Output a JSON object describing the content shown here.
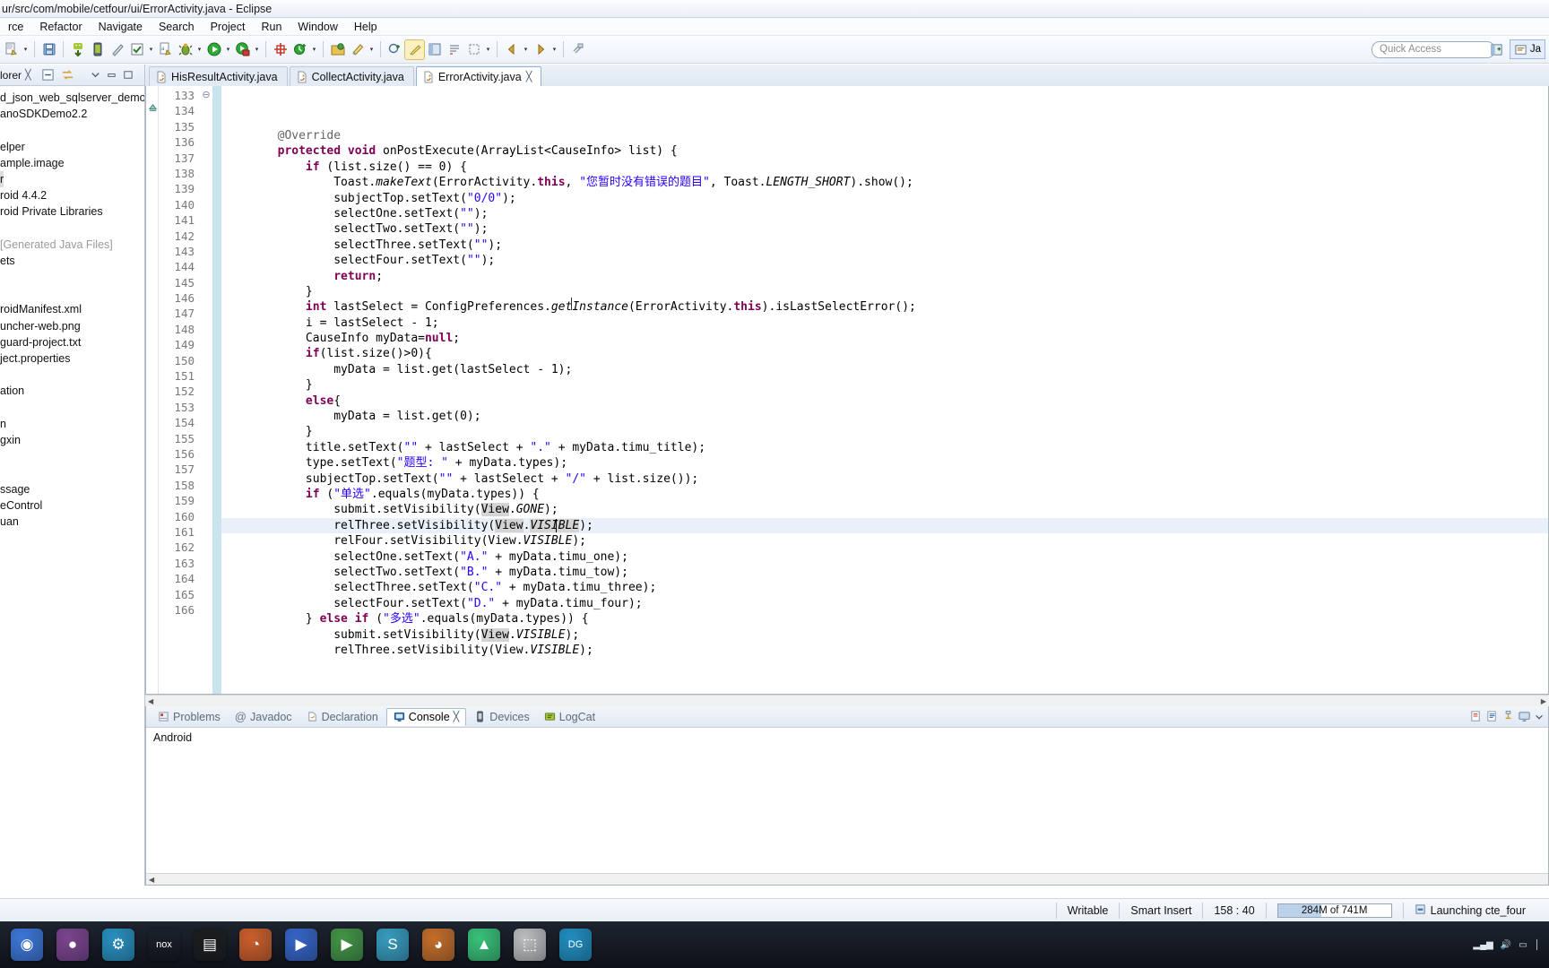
{
  "window": {
    "title": "ur/src/com/mobile/cetfour/ui/ErrorActivity.java - Eclipse"
  },
  "menubar": {
    "items": [
      "rce",
      "Refactor",
      "Navigate",
      "Search",
      "Project",
      "Run",
      "Window",
      "Help"
    ]
  },
  "toolbar": {
    "quick_access_placeholder": "Quick Access",
    "icons": [
      "new-wizard-icon",
      "save-icon",
      "android-sdk-manager-icon",
      "android-avd-manager-icon",
      "new-xml-file-icon",
      "check-icon",
      "new-java-class-icon",
      "debug-icon",
      "run-icon",
      "run-coverage-icon",
      "new-android-icon",
      "external-tools-icon",
      "open-type-icon",
      "search-icon",
      "next-annotation-icon",
      "java-perspective-icon",
      "open-perspective-icon"
    ],
    "perspective_label": "Ja"
  },
  "explorer": {
    "tab_label": "lorer",
    "tab_close": "╳",
    "toolbar_icons": [
      "collapse-all-icon",
      "link-with-editor-icon",
      "view-menu-icon",
      "minimize-icon",
      "maximize-icon"
    ],
    "tree": [
      {
        "label": "d_json_web_sqlserver_demo",
        "style": "normal"
      },
      {
        "label": "anoSDKDemo2.2",
        "style": "normal"
      },
      {
        "label": "",
        "style": "blank"
      },
      {
        "label": "elper",
        "style": "normal"
      },
      {
        "label": "ample.image",
        "style": "normal"
      },
      {
        "label": "r",
        "style": "selected"
      },
      {
        "label": "roid 4.4.2",
        "style": "normal"
      },
      {
        "label": "roid Private Libraries",
        "style": "normal"
      },
      {
        "label": "",
        "style": "blank"
      },
      {
        "label": "[Generated Java Files]",
        "style": "gray"
      },
      {
        "label": "ets",
        "style": "normal"
      },
      {
        "label": "",
        "style": "blank"
      },
      {
        "label": "",
        "style": "blank"
      },
      {
        "label": "roidManifest.xml",
        "style": "normal"
      },
      {
        "label": "uncher-web.png",
        "style": "normal"
      },
      {
        "label": "guard-project.txt",
        "style": "normal"
      },
      {
        "label": "ject.properties",
        "style": "normal"
      },
      {
        "label": "",
        "style": "blank"
      },
      {
        "label": "ation",
        "style": "normal"
      },
      {
        "label": "",
        "style": "blank"
      },
      {
        "label": "n",
        "style": "normal"
      },
      {
        "label": "gxin",
        "style": "normal"
      },
      {
        "label": "",
        "style": "blank"
      },
      {
        "label": "",
        "style": "blank"
      },
      {
        "label": "ssage",
        "style": "normal"
      },
      {
        "label": "eControl",
        "style": "normal"
      },
      {
        "label": "uan",
        "style": "normal"
      }
    ]
  },
  "editor": {
    "tabs": [
      {
        "label": "HisResultActivity.java",
        "active": false,
        "closable": false
      },
      {
        "label": "CollectActivity.java",
        "active": false,
        "closable": false
      },
      {
        "label": "ErrorActivity.java",
        "active": true,
        "closable": true,
        "close_glyph": "╳"
      }
    ],
    "first_line": 133,
    "lines": [
      {
        "n": 133,
        "fold": "collapse",
        "tokens": [
          {
            "t": "        ",
            "c": ""
          },
          {
            "t": "@Override",
            "c": "ann"
          }
        ]
      },
      {
        "n": 134,
        "mark": "overrides",
        "tokens": [
          {
            "t": "        ",
            "c": ""
          },
          {
            "t": "protected void",
            "c": "kw"
          },
          {
            "t": " onPostExecute(ArrayList<CauseInfo> list) {",
            "c": ""
          }
        ]
      },
      {
        "n": 135,
        "tokens": [
          {
            "t": "            ",
            "c": ""
          },
          {
            "t": "if",
            "c": "kw"
          },
          {
            "t": " (list.size() == 0) {",
            "c": ""
          }
        ]
      },
      {
        "n": 136,
        "tokens": [
          {
            "t": "                Toast.",
            "c": ""
          },
          {
            "t": "makeText",
            "c": "stat"
          },
          {
            "t": "(ErrorActivity.",
            "c": ""
          },
          {
            "t": "this",
            "c": "kw"
          },
          {
            "t": ", ",
            "c": ""
          },
          {
            "t": "\"您暂时没有错误的题目\"",
            "c": "str"
          },
          {
            "t": ", Toast.",
            "c": ""
          },
          {
            "t": "LENGTH_SHORT",
            "c": "stat"
          },
          {
            "t": ").show();",
            "c": ""
          }
        ]
      },
      {
        "n": 137,
        "tokens": [
          {
            "t": "                subjectTop.setText(",
            "c": ""
          },
          {
            "t": "\"0/0\"",
            "c": "str"
          },
          {
            "t": ");",
            "c": ""
          }
        ]
      },
      {
        "n": 138,
        "tokens": [
          {
            "t": "                selectOne.setText(",
            "c": ""
          },
          {
            "t": "\"\"",
            "c": "str"
          },
          {
            "t": ");",
            "c": ""
          }
        ]
      },
      {
        "n": 139,
        "tokens": [
          {
            "t": "                selectTwo.setText(",
            "c": ""
          },
          {
            "t": "\"\"",
            "c": "str"
          },
          {
            "t": ");",
            "c": ""
          }
        ]
      },
      {
        "n": 140,
        "tokens": [
          {
            "t": "                selectThree.setText(",
            "c": ""
          },
          {
            "t": "\"\"",
            "c": "str"
          },
          {
            "t": ");",
            "c": ""
          }
        ]
      },
      {
        "n": 141,
        "tokens": [
          {
            "t": "                selectFour.setText(",
            "c": ""
          },
          {
            "t": "\"\"",
            "c": "str"
          },
          {
            "t": ");",
            "c": ""
          }
        ]
      },
      {
        "n": 142,
        "tokens": [
          {
            "t": "                ",
            "c": ""
          },
          {
            "t": "return",
            "c": "kw"
          },
          {
            "t": ";",
            "c": ""
          }
        ]
      },
      {
        "n": 143,
        "tokens": [
          {
            "t": "            }",
            "c": ""
          }
        ]
      },
      {
        "n": 144,
        "tokens": [
          {
            "t": "            ",
            "c": ""
          },
          {
            "t": "int",
            "c": "kw"
          },
          {
            "t": " lastSelect = ConfigPreferences.",
            "c": ""
          },
          {
            "t": "getInstance",
            "c": "stat"
          },
          {
            "t": "(ErrorActivity.",
            "c": ""
          },
          {
            "t": "this",
            "c": "kw"
          },
          {
            "t": ").isLastSelectError();",
            "c": ""
          }
        ]
      },
      {
        "n": 145,
        "tokens": [
          {
            "t": "            i = lastSelect - 1;",
            "c": ""
          }
        ]
      },
      {
        "n": 146,
        "tokens": [
          {
            "t": "            CauseInfo myData=",
            "c": ""
          },
          {
            "t": "null",
            "c": "kw"
          },
          {
            "t": ";",
            "c": ""
          }
        ]
      },
      {
        "n": 147,
        "tokens": [
          {
            "t": "            ",
            "c": ""
          },
          {
            "t": "if",
            "c": "kw"
          },
          {
            "t": "(list.size()>0){",
            "c": ""
          }
        ]
      },
      {
        "n": 148,
        "tokens": [
          {
            "t": "                myData = list.get(lastSelect - 1);",
            "c": ""
          }
        ]
      },
      {
        "n": 149,
        "tokens": [
          {
            "t": "            }",
            "c": ""
          }
        ]
      },
      {
        "n": 150,
        "tokens": [
          {
            "t": "            ",
            "c": ""
          },
          {
            "t": "else",
            "c": "kw"
          },
          {
            "t": "{",
            "c": ""
          }
        ]
      },
      {
        "n": 151,
        "tokens": [
          {
            "t": "                myData = list.get(0);",
            "c": ""
          }
        ]
      },
      {
        "n": 152,
        "tokens": [
          {
            "t": "            }",
            "c": ""
          }
        ]
      },
      {
        "n": 153,
        "tokens": [
          {
            "t": "            title.setText(",
            "c": ""
          },
          {
            "t": "\"\"",
            "c": "str"
          },
          {
            "t": " + lastSelect + ",
            "c": ""
          },
          {
            "t": "\".\"",
            "c": "str"
          },
          {
            "t": " + myData.timu_title);",
            "c": ""
          }
        ]
      },
      {
        "n": 154,
        "tokens": [
          {
            "t": "            type.setText(",
            "c": ""
          },
          {
            "t": "\"题型: \"",
            "c": "str"
          },
          {
            "t": " + myData.types);",
            "c": ""
          }
        ]
      },
      {
        "n": 155,
        "tokens": [
          {
            "t": "            subjectTop.setText(",
            "c": ""
          },
          {
            "t": "\"\"",
            "c": "str"
          },
          {
            "t": " + lastSelect + ",
            "c": ""
          },
          {
            "t": "\"/\"",
            "c": "str"
          },
          {
            "t": " + list.size());",
            "c": ""
          }
        ]
      },
      {
        "n": 156,
        "tokens": [
          {
            "t": "            ",
            "c": ""
          },
          {
            "t": "if",
            "c": "kw"
          },
          {
            "t": " (",
            "c": ""
          },
          {
            "t": "\"单选\"",
            "c": "str"
          },
          {
            "t": ".equals(myData.types)) {",
            "c": ""
          }
        ]
      },
      {
        "n": 157,
        "tokens": [
          {
            "t": "                submit.setVisibility(",
            "c": ""
          },
          {
            "t": "View",
            "c": "occ"
          },
          {
            "t": ".",
            "c": ""
          },
          {
            "t": "GONE",
            "c": "stat"
          },
          {
            "t": ");",
            "c": ""
          }
        ]
      },
      {
        "n": 158,
        "highlight": true,
        "caret": true,
        "tokens": [
          {
            "t": "                relThree.setVisibility(",
            "c": ""
          },
          {
            "t": "View",
            "c": "occ"
          },
          {
            "t": ".",
            "c": ""
          },
          {
            "t": "VISIBLE",
            "c": "stat occ"
          },
          {
            "t": ");",
            "c": ""
          }
        ]
      },
      {
        "n": 159,
        "tokens": [
          {
            "t": "                relFour.setVisibility(View.",
            "c": ""
          },
          {
            "t": "VISIBLE",
            "c": "stat"
          },
          {
            "t": ");",
            "c": ""
          }
        ]
      },
      {
        "n": 160,
        "tokens": [
          {
            "t": "                selectOne.setText(",
            "c": ""
          },
          {
            "t": "\"A.\"",
            "c": "str"
          },
          {
            "t": " + myData.timu_one);",
            "c": ""
          }
        ]
      },
      {
        "n": 161,
        "tokens": [
          {
            "t": "                selectTwo.setText(",
            "c": ""
          },
          {
            "t": "\"B.\"",
            "c": "str"
          },
          {
            "t": " + myData.timu_tow);",
            "c": ""
          }
        ]
      },
      {
        "n": 162,
        "tokens": [
          {
            "t": "                selectThree.setText(",
            "c": ""
          },
          {
            "t": "\"C.\"",
            "c": "str"
          },
          {
            "t": " + myData.timu_three);",
            "c": ""
          }
        ]
      },
      {
        "n": 163,
        "tokens": [
          {
            "t": "                selectFour.setText(",
            "c": ""
          },
          {
            "t": "\"D.\"",
            "c": "str"
          },
          {
            "t": " + myData.timu_four);",
            "c": ""
          }
        ]
      },
      {
        "n": 164,
        "tokens": [
          {
            "t": "            } ",
            "c": ""
          },
          {
            "t": "else if",
            "c": "kw"
          },
          {
            "t": " (",
            "c": ""
          },
          {
            "t": "\"多选\"",
            "c": "str"
          },
          {
            "t": ".equals(myData.types)) {",
            "c": ""
          }
        ]
      },
      {
        "n": 165,
        "tokens": [
          {
            "t": "                submit.setVisibility(",
            "c": ""
          },
          {
            "t": "View",
            "c": "occ"
          },
          {
            "t": ".",
            "c": ""
          },
          {
            "t": "VISIBLE",
            "c": "stat"
          },
          {
            "t": ");",
            "c": ""
          }
        ]
      },
      {
        "n": 166,
        "tokens": [
          {
            "t": "                relThree.setVisibility(View.",
            "c": ""
          },
          {
            "t": "VISIBLE",
            "c": "stat"
          },
          {
            "t": ");",
            "c": ""
          }
        ]
      }
    ]
  },
  "console_panel": {
    "tabs": [
      {
        "label": "Problems",
        "icon": "problems-icon",
        "active": false
      },
      {
        "label": "Javadoc",
        "icon": "javadoc-icon",
        "active": false
      },
      {
        "label": "Declaration",
        "icon": "declaration-icon",
        "active": false
      },
      {
        "label": "Console",
        "icon": "console-icon",
        "active": true,
        "close_glyph": "╳"
      },
      {
        "label": "Devices",
        "icon": "devices-icon",
        "active": false
      },
      {
        "label": "LogCat",
        "icon": "logcat-icon",
        "active": false
      }
    ],
    "body_text": "Android",
    "tool_icons": [
      "clear-console-icon",
      "scroll-lock-icon",
      "pin-console-icon",
      "display-console-icon",
      "view-menu-icon"
    ]
  },
  "statusbar": {
    "writable": "Writable",
    "insert_mode": "Smart Insert",
    "cursor_position": "158 : 40",
    "memory": "284M of 741M",
    "job": "Launching cte_four",
    "job_icon": "progress-icon"
  },
  "taskbar": {
    "apps": [
      {
        "name": "chrome-icon",
        "glyph": "◉",
        "color": "#4285f4"
      },
      {
        "name": "media-player-icon",
        "glyph": "●",
        "color": "#8b4a9e"
      },
      {
        "name": "settings-blue-icon",
        "glyph": "⚙",
        "color": "#2aa3d8"
      },
      {
        "name": "nox-player-icon",
        "glyph": "nox",
        "color": "#222"
      },
      {
        "name": "file-explorer-icon",
        "glyph": "▤",
        "color": "#1b1b1b"
      },
      {
        "name": "firefox-icon",
        "glyph": "◔",
        "color": "#e8682a"
      },
      {
        "name": "video-player-icon",
        "glyph": "▶",
        "color": "#3a6fe0"
      },
      {
        "name": "player-green-icon",
        "glyph": "▶",
        "color": "#49a84a"
      },
      {
        "name": "sublime-icon",
        "glyph": "S",
        "color": "#3db0d6"
      },
      {
        "name": "eclipse-icon",
        "glyph": "◕",
        "color": "#e07a28"
      },
      {
        "name": "android-studio-icon",
        "glyph": "▲",
        "color": "#3ddc84"
      },
      {
        "name": "calculator-icon",
        "glyph": "⬚",
        "color": "#d7d7d7"
      },
      {
        "name": "datagrip-icon",
        "glyph": "DG",
        "color": "#21a0d8"
      }
    ],
    "tray_icons": [
      "network-icon",
      "volume-icon",
      "battery-icon",
      "show-desktop-icon"
    ]
  }
}
